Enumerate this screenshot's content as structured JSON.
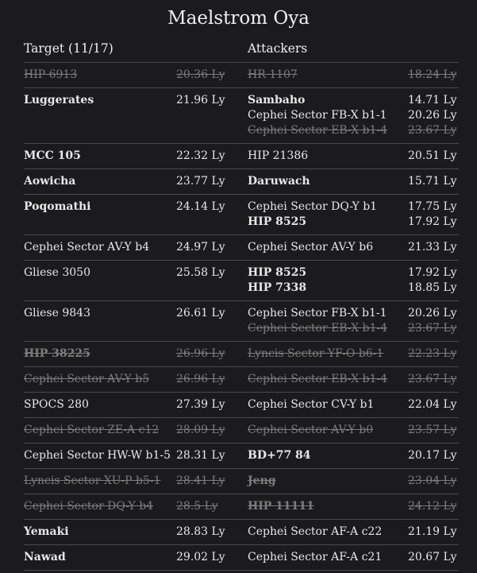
{
  "title": "Maelstrom Oya",
  "headers": {
    "target": "Target (11/17)",
    "attackers": "Attackers"
  },
  "rows": [
    {
      "target": {
        "name": "HIP 6913",
        "dist": "20.36 Ly",
        "style": "strike"
      },
      "attackers": [
        {
          "name": "HR 1107",
          "dist": "18.24 Ly",
          "style": "strike"
        }
      ]
    },
    {
      "target": {
        "name": "Luggerates",
        "dist": "21.96 Ly",
        "style": "bold"
      },
      "attackers": [
        {
          "name": "Sambaho",
          "dist": "14.71 Ly",
          "style": "bold"
        },
        {
          "name": "Cephei Sector FB-X b1-1",
          "dist": "20.26 Ly",
          "style": "normal"
        },
        {
          "name": "Cephei Sector EB-X b1-4",
          "dist": "23.67 Ly",
          "style": "strike"
        }
      ]
    },
    {
      "target": {
        "name": "MCC 105",
        "dist": "22.32 Ly",
        "style": "bold"
      },
      "attackers": [
        {
          "name": "HIP 21386",
          "dist": "20.51 Ly",
          "style": "normal"
        }
      ]
    },
    {
      "target": {
        "name": "Aowicha",
        "dist": "23.77 Ly",
        "style": "bold"
      },
      "attackers": [
        {
          "name": "Daruwach",
          "dist": "15.71 Ly",
          "style": "bold"
        }
      ]
    },
    {
      "target": {
        "name": "Poqomathi",
        "dist": "24.14 Ly",
        "style": "bold"
      },
      "attackers": [
        {
          "name": "Cephei Sector DQ-Y b1",
          "dist": "17.75 Ly",
          "style": "normal"
        },
        {
          "name": "HIP 8525",
          "dist": "17.92 Ly",
          "style": "bold"
        }
      ]
    },
    {
      "target": {
        "name": "Cephei Sector AV-Y b4",
        "dist": "24.97 Ly",
        "style": "normal"
      },
      "attackers": [
        {
          "name": "Cephei Sector AV-Y b6",
          "dist": "21.33 Ly",
          "style": "normal"
        }
      ]
    },
    {
      "target": {
        "name": "Gliese 3050",
        "dist": "25.58 Ly",
        "style": "normal"
      },
      "attackers": [
        {
          "name": "HIP 8525",
          "dist": "17.92 Ly",
          "style": "bold"
        },
        {
          "name": "HIP 7338",
          "dist": "18.85 Ly",
          "style": "bold"
        }
      ]
    },
    {
      "target": {
        "name": "Gliese 9843",
        "dist": "26.61 Ly",
        "style": "normal"
      },
      "attackers": [
        {
          "name": "Cephei Sector FB-X b1-1",
          "dist": "20.26 Ly",
          "style": "normal"
        },
        {
          "name": "Cephei Sector EB-X b1-4",
          "dist": "23.67 Ly",
          "style": "strike"
        }
      ]
    },
    {
      "target": {
        "name": "HIP 38225",
        "dist": "26.96 Ly",
        "style": "strike-bold"
      },
      "attackers": [
        {
          "name": "Lyncis Sector YF-O b6-1",
          "dist": "22.23 Ly",
          "style": "strike"
        }
      ]
    },
    {
      "target": {
        "name": "Cephei Sector AV-Y b5",
        "dist": "26.96 Ly",
        "style": "strike"
      },
      "attackers": [
        {
          "name": "Cephei Sector EB-X b1-4",
          "dist": "23.67 Ly",
          "style": "strike"
        }
      ]
    },
    {
      "target": {
        "name": "SPOCS 280",
        "dist": "27.39 Ly",
        "style": "normal"
      },
      "attackers": [
        {
          "name": "Cephei Sector CV-Y b1",
          "dist": "22.04 Ly",
          "style": "normal"
        }
      ]
    },
    {
      "target": {
        "name": "Cephei Sector ZE-A c12",
        "dist": "28.09 Ly",
        "style": "strike"
      },
      "attackers": [
        {
          "name": "Cephei Sector AV-Y b0",
          "dist": "23.57 Ly",
          "style": "strike"
        }
      ]
    },
    {
      "target": {
        "name": "Cephei Sector HW-W b1-5",
        "dist": "28.31 Ly",
        "style": "normal"
      },
      "attackers": [
        {
          "name": "BD+77 84",
          "dist": "20.17 Ly",
          "style": "bold"
        }
      ]
    },
    {
      "target": {
        "name": "Lyncis Sector XU-P b5-1",
        "dist": "28.41 Ly",
        "style": "strike"
      },
      "attackers": [
        {
          "name": "Jeng",
          "dist": "23.04 Ly",
          "style": "strike-bold"
        }
      ]
    },
    {
      "target": {
        "name": "Cephei Sector DQ-Y b4",
        "dist": "28.5 Ly",
        "style": "strike"
      },
      "attackers": [
        {
          "name": "HIP 11111",
          "dist": "24.12 Ly",
          "style": "strike-bold"
        }
      ]
    },
    {
      "target": {
        "name": "Yemaki",
        "dist": "28.83 Ly",
        "style": "bold"
      },
      "attackers": [
        {
          "name": "Cephei Sector AF-A c22",
          "dist": "21.19 Ly",
          "style": "normal"
        }
      ]
    },
    {
      "target": {
        "name": "Nawad",
        "dist": "29.02 Ly",
        "style": "bold"
      },
      "attackers": [
        {
          "name": "Cephei Sector AF-A c21",
          "dist": "20.67 Ly",
          "style": "normal"
        }
      ]
    }
  ]
}
